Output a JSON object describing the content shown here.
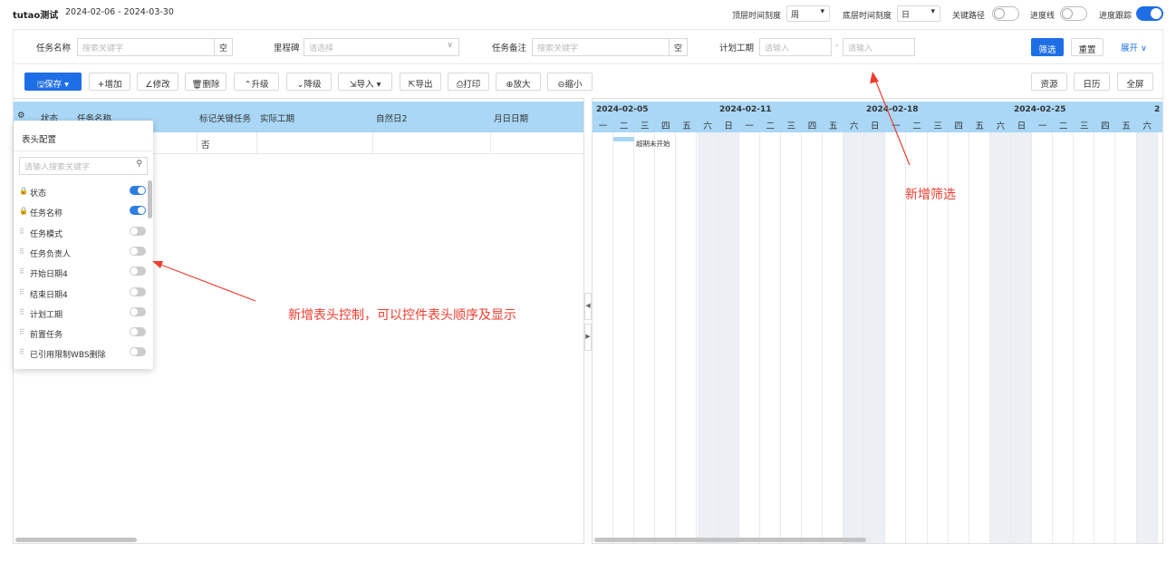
{
  "header": {
    "title": "tutao测试",
    "date_range": "2024-02-06 - 2024-03-30",
    "top_scale_label": "顶层时间刻度",
    "top_scale_value": "周",
    "bottom_scale_label": "底层时间刻度",
    "bottom_scale_value": "日",
    "critical_path_label": "关键路径",
    "critical_path_on": false,
    "progress_line_label": "进度线",
    "progress_line_on": false,
    "progress_track_label": "进度跟踪",
    "progress_track_on": true
  },
  "filters": {
    "task_name_label": "任务名称",
    "task_name_placeholder": "搜索关键字",
    "task_name_suffix": "空",
    "milestone_label": "里程碑",
    "milestone_placeholder": "请选择",
    "note_label": "任务备注",
    "note_placeholder": "搜索关键字",
    "note_suffix": "空",
    "planned_label": "计划工期",
    "planned_from_placeholder": "请输入",
    "planned_sep": "-",
    "planned_to_placeholder": "请输入",
    "filter_btn": "筛选",
    "reset_btn": "重置",
    "expand_btn": "展开"
  },
  "toolbar": {
    "save": "保存",
    "add": "增加",
    "edit": "修改",
    "delete": "删除",
    "upgrade": "升级",
    "downgrade": "降级",
    "import": "导入",
    "export": "导出",
    "print": "打印",
    "zoom_in": "放大",
    "zoom_out": "缩小",
    "resource": "资源",
    "calendar": "日历",
    "fullscreen": "全屏"
  },
  "grid": {
    "columns": [
      "状态",
      "任务名称",
      "标记关键任务",
      "实际工期",
      "自然日2",
      "月日日期"
    ],
    "rows": [
      {
        "flag_critical": "否"
      }
    ]
  },
  "column_config": {
    "title": "表头配置",
    "search_placeholder": "请输入搜索关键字",
    "items": [
      {
        "label": "状态",
        "locked": true,
        "on": true
      },
      {
        "label": "任务名称",
        "locked": true,
        "on": true
      },
      {
        "label": "任务模式",
        "locked": false,
        "on": false
      },
      {
        "label": "任务负责人",
        "locked": false,
        "on": false
      },
      {
        "label": "开始日期4",
        "locked": false,
        "on": false
      },
      {
        "label": "结束日期4",
        "locked": false,
        "on": false
      },
      {
        "label": "计划工期",
        "locked": false,
        "on": false
      },
      {
        "label": "前置任务",
        "locked": false,
        "on": false
      },
      {
        "label": "已引用限制WBS删除",
        "locked": false,
        "on": false
      }
    ]
  },
  "gantt": {
    "weeks": [
      "2024-02-05",
      "2024-02-11",
      "2024-02-18",
      "2024-02-25",
      "2"
    ],
    "days": [
      "一",
      "二",
      "三",
      "四",
      "五",
      "六",
      "日",
      "一",
      "二",
      "三",
      "四",
      "五",
      "六",
      "日",
      "一",
      "二",
      "三",
      "四",
      "五",
      "六",
      "日",
      "一",
      "二",
      "三",
      "四",
      "五",
      "六"
    ],
    "bar_label": "超期未开始",
    "accent": "#a9d7f5"
  },
  "annotations": {
    "column_control": "新增表头控制，可以控件表头顺序及显示",
    "new_filter": "新增筛选",
    "color": "#f03c2e"
  }
}
